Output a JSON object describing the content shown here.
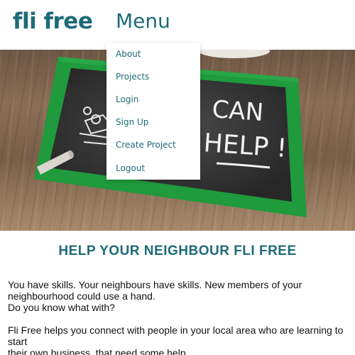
{
  "header": {
    "logo": "fli free",
    "menu_label": "Menu"
  },
  "menu": {
    "items": [
      "About",
      "Projects",
      "Login",
      "Sign Up",
      "Create Project",
      "Logout"
    ]
  },
  "hero": {
    "chalk_line1": "CAN",
    "chalk_line2": "HELP !"
  },
  "main": {
    "headline": "HELP YOUR NEIGHBOUR FLI FREE",
    "para1_line1": "You have skills. Your neighbours have skills. New members of your",
    "para1_line2": "neighbourhood could use a hand.",
    "para1_line3": "Do you know what with?",
    "para2_line1": "Fli Free helps you connect with people in your local area who are learning to start",
    "para2_line2": "their own business, that need some help."
  },
  "colors": {
    "brand": "#1e6a78",
    "frame_green": "#1f9a3c",
    "chalkboard": "#2a2a2a"
  }
}
